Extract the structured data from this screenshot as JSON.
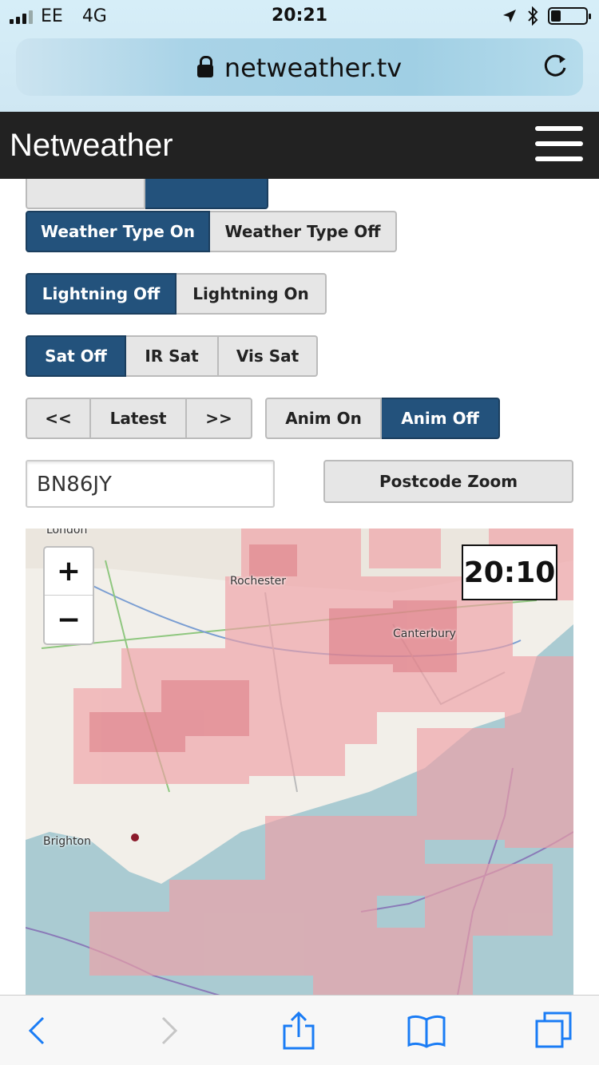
{
  "status_bar": {
    "carrier": "EE",
    "network": "4G",
    "time": "20:21"
  },
  "browser": {
    "url": "netweather.tv"
  },
  "site": {
    "title": "Netweather"
  },
  "controls": {
    "weather_type": [
      "Weather Type On",
      "Weather Type Off"
    ],
    "lightning": [
      "Lightning Off",
      "Lightning On"
    ],
    "satellite": [
      "Sat Off",
      "IR Sat",
      "Vis Sat"
    ],
    "nav": [
      "<<",
      "Latest",
      ">>"
    ],
    "anim": [
      "Anim On",
      "Anim Off"
    ],
    "postcode_value": "BN86JY",
    "postcode_button": "Postcode Zoom"
  },
  "map": {
    "zoom_in": "+",
    "zoom_out": "−",
    "time": "20:10",
    "labels": [
      "London",
      "Rochester",
      "Canterbury",
      "Brighton"
    ]
  },
  "colors": {
    "active_button": "#23527c",
    "header_bg": "#222222",
    "radar": "#f0a0a6"
  },
  "icons": {
    "back": "chevron-left-icon",
    "forward": "chevron-right-icon",
    "share": "share-icon",
    "bookmarks": "book-icon",
    "tabs": "tabs-icon"
  }
}
